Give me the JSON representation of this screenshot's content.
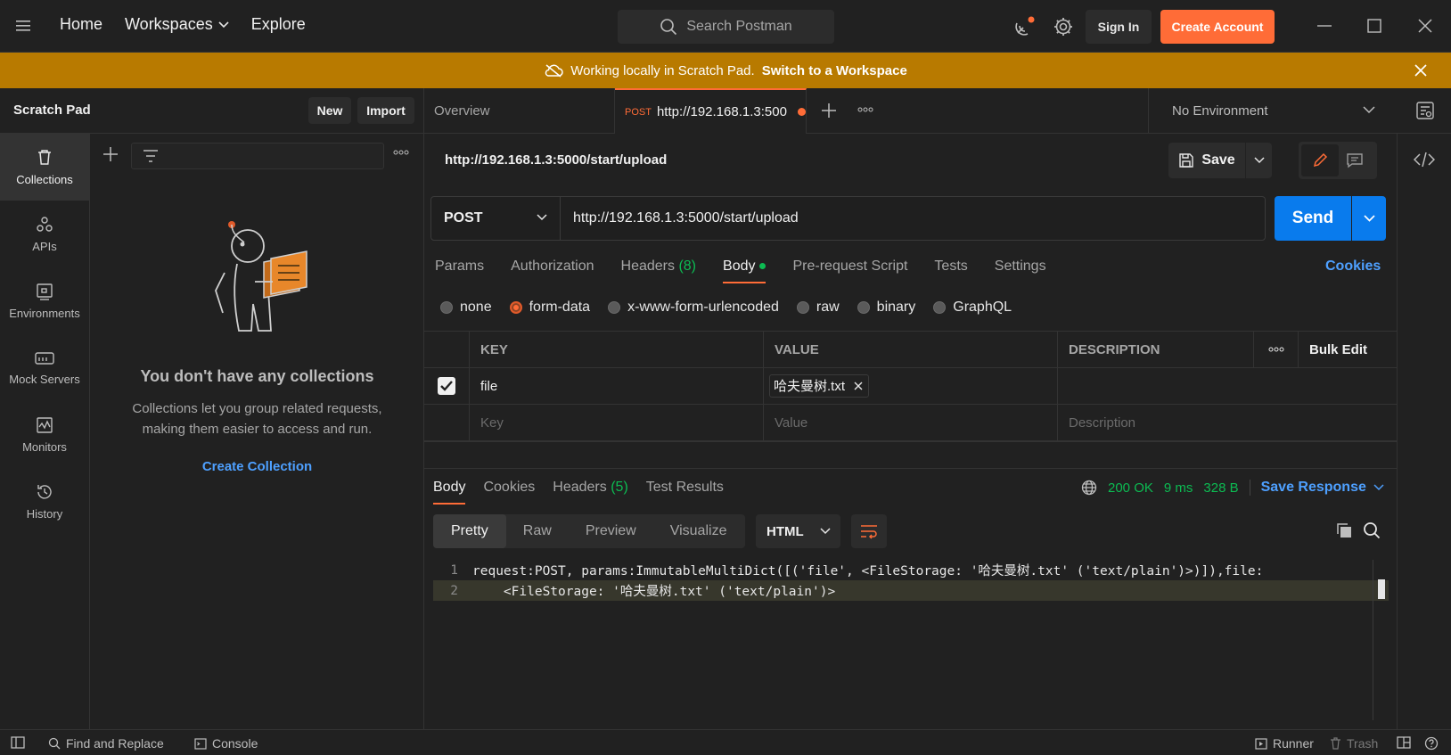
{
  "topbar": {
    "nav": [
      "Home",
      "Workspaces",
      "Explore"
    ],
    "search_placeholder": "Search Postman",
    "signin": "Sign In",
    "create_account": "Create Account",
    "accent": "#ff6c37"
  },
  "banner": {
    "text": "Working locally in Scratch Pad.",
    "link": "Switch to a Workspace",
    "color": "#b87a00"
  },
  "sidebar": {
    "title": "Scratch Pad",
    "new_label": "New",
    "import_label": "Import",
    "items": [
      {
        "label": "Collections",
        "icon": "trash-can-icon",
        "active": true
      },
      {
        "label": "APIs",
        "icon": "apis-icon"
      },
      {
        "label": "Environments",
        "icon": "environment-icon"
      },
      {
        "label": "Mock Servers",
        "icon": "mock-server-icon"
      },
      {
        "label": "Monitors",
        "icon": "monitor-icon"
      },
      {
        "label": "History",
        "icon": "history-icon"
      }
    ],
    "empty_title": "You don't have any collections",
    "empty_desc": "Collections let you group related requests, making them easier to access and run.",
    "create_collection": "Create Collection"
  },
  "tabs": {
    "overview": "Overview",
    "request_method": "POST",
    "request_title": "http://192.168.1.3:500",
    "environment": "No Environment"
  },
  "request": {
    "name": "http://192.168.1.3:5000/start/upload",
    "save": "Save",
    "method": "POST",
    "url": "http://192.168.1.3:5000/start/upload",
    "send": "Send",
    "tabs": [
      "Params",
      "Authorization",
      "Headers",
      "Body",
      "Pre-request Script",
      "Tests",
      "Settings"
    ],
    "headers_count": "(8)",
    "cookies": "Cookies",
    "body_types": [
      "none",
      "form-data",
      "x-www-form-urlencoded",
      "raw",
      "binary",
      "GraphQL"
    ],
    "selected_body_type": "form-data",
    "table": {
      "columns": [
        "KEY",
        "VALUE",
        "DESCRIPTION"
      ],
      "bulk_edit": "Bulk Edit",
      "rows": [
        {
          "checked": true,
          "key": "file",
          "value": "哈夫曼树.txt",
          "description": ""
        }
      ],
      "key_placeholder": "Key",
      "value_placeholder": "Value",
      "description_placeholder": "Description"
    }
  },
  "response": {
    "tabs": [
      "Body",
      "Cookies",
      "Headers",
      "Test Results"
    ],
    "headers_count": "(5)",
    "status": "200 OK",
    "time": "9 ms",
    "size": "328 B",
    "save_response": "Save Response",
    "views": [
      "Pretty",
      "Raw",
      "Preview",
      "Visualize"
    ],
    "format": "HTML",
    "lines": [
      {
        "n": "1",
        "text": "request:POST, params:ImmutableMultiDict([('file', <FileStorage: '哈夫曼树.txt' ('text/plain')>)]),file:"
      },
      {
        "n": "2",
        "text": "    <FileStorage: '哈夫曼树.txt' ('text/plain')>"
      }
    ]
  },
  "statusbar": {
    "find_replace": "Find and Replace",
    "console": "Console",
    "runner": "Runner",
    "trash": "Trash"
  }
}
